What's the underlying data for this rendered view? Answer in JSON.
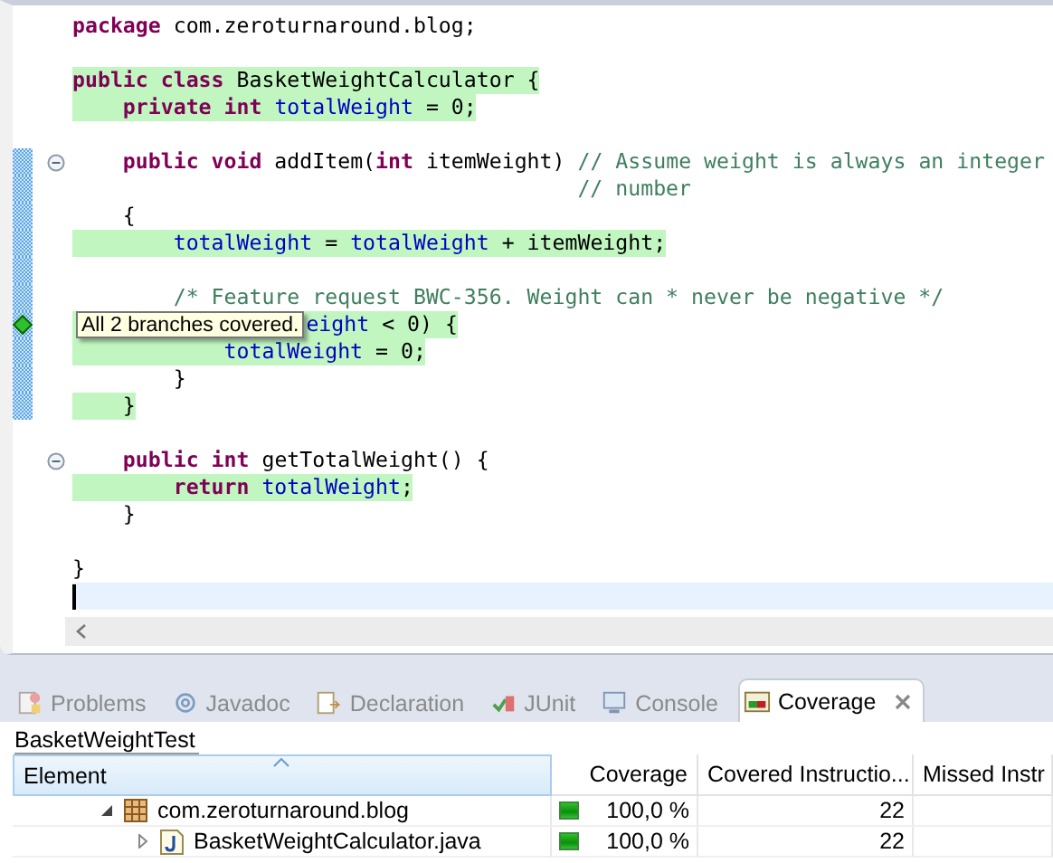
{
  "editor": {
    "lines": [
      {
        "kind": "code",
        "covered": false,
        "in_range": false,
        "fold": false,
        "tokens": [
          {
            "kind": "keyword",
            "text": "package"
          },
          {
            "kind": "plain",
            "text": " com.zeroturnaround.blog;"
          }
        ]
      },
      {
        "kind": "blank",
        "in_range": false
      },
      {
        "kind": "code",
        "covered": true,
        "in_range": false,
        "fold": false,
        "tokens": [
          {
            "kind": "keyword",
            "text": "public class"
          },
          {
            "kind": "plain",
            "text": " BasketWeightCalculator {"
          }
        ]
      },
      {
        "kind": "code",
        "covered": true,
        "in_range": false,
        "fold": false,
        "tokens": [
          {
            "kind": "keyword",
            "text": "    private int "
          },
          {
            "kind": "field",
            "text": "totalWeight"
          },
          {
            "kind": "plain",
            "text": " = 0;"
          }
        ]
      },
      {
        "kind": "blank",
        "in_range": false
      },
      {
        "kind": "code",
        "covered": false,
        "in_range": true,
        "fold": true,
        "tokens": [
          {
            "kind": "keyword",
            "text": "    public void"
          },
          {
            "kind": "plain",
            "text": " addItem("
          },
          {
            "kind": "keyword",
            "text": "int"
          },
          {
            "kind": "plain",
            "text": " itemWeight) "
          },
          {
            "kind": "comment",
            "text": "// Assume weight is always an integer"
          }
        ]
      },
      {
        "kind": "code",
        "covered": false,
        "in_range": true,
        "fold": false,
        "tokens": [
          {
            "kind": "comment",
            "text": "                                        // number"
          }
        ]
      },
      {
        "kind": "code",
        "covered": false,
        "in_range": true,
        "fold": false,
        "tokens": [
          {
            "kind": "plain",
            "text": "    {"
          }
        ]
      },
      {
        "kind": "code",
        "covered": true,
        "in_range": true,
        "fold": false,
        "tokens": [
          {
            "kind": "field",
            "text": "        totalWeight"
          },
          {
            "kind": "plain",
            "text": " = "
          },
          {
            "kind": "field",
            "text": "totalWeight"
          },
          {
            "kind": "plain",
            "text": " + itemWeight;"
          }
        ]
      },
      {
        "kind": "blank",
        "in_range": true
      },
      {
        "kind": "code",
        "covered": false,
        "in_range": true,
        "fold": false,
        "tokens": [
          {
            "kind": "comment",
            "text": "        /* Feature request BWC-356. Weight can * never be negative */"
          }
        ]
      },
      {
        "kind": "code",
        "covered": true,
        "in_range": true,
        "fold": false,
        "branch_covered": true,
        "tooltip": "All 2 branches covered.",
        "tokens": [
          {
            "kind": "field",
            "text": "eight"
          },
          {
            "kind": "plain",
            "text": " < 0) {"
          }
        ]
      },
      {
        "kind": "code",
        "covered": true,
        "in_range": true,
        "fold": false,
        "tokens": [
          {
            "kind": "field",
            "text": "            totalWeight"
          },
          {
            "kind": "plain",
            "text": " = 0;"
          }
        ]
      },
      {
        "kind": "code",
        "covered": false,
        "in_range": true,
        "fold": false,
        "tokens": [
          {
            "kind": "plain",
            "text": "        }"
          }
        ]
      },
      {
        "kind": "code",
        "covered": true,
        "in_range": true,
        "fold": false,
        "tokens": [
          {
            "kind": "plain",
            "text": "    }"
          }
        ]
      },
      {
        "kind": "blank",
        "in_range": false
      },
      {
        "kind": "code",
        "covered": false,
        "in_range": false,
        "fold": true,
        "tokens": [
          {
            "kind": "keyword",
            "text": "    public int"
          },
          {
            "kind": "plain",
            "text": " getTotalWeight() {"
          }
        ]
      },
      {
        "kind": "code",
        "covered": true,
        "in_range": false,
        "fold": false,
        "tokens": [
          {
            "kind": "keyword",
            "text": "        return "
          },
          {
            "kind": "field",
            "text": "totalWeight"
          },
          {
            "kind": "plain",
            "text": ";"
          }
        ]
      },
      {
        "kind": "code",
        "covered": false,
        "in_range": false,
        "fold": false,
        "tokens": [
          {
            "kind": "plain",
            "text": "    }"
          }
        ]
      },
      {
        "kind": "blank",
        "in_range": false
      },
      {
        "kind": "code",
        "covered": false,
        "in_range": false,
        "fold": false,
        "tokens": [
          {
            "kind": "plain",
            "text": "}"
          }
        ]
      },
      {
        "kind": "cursor",
        "in_range": false
      }
    ]
  },
  "tabs": [
    {
      "label": "Problems",
      "kind": "problems",
      "selected": false
    },
    {
      "label": "Javadoc",
      "kind": "javadoc",
      "selected": false
    },
    {
      "label": "Declaration",
      "kind": "declaration",
      "selected": false
    },
    {
      "label": "JUnit",
      "kind": "junit",
      "selected": false
    },
    {
      "label": "Console",
      "kind": "console",
      "selected": false
    },
    {
      "label": "Coverage",
      "kind": "coverage",
      "selected": true
    }
  ],
  "session": "BasketWeightTest",
  "table": {
    "columns": [
      "Element",
      "Coverage",
      "Covered Instructio...",
      "Missed Instr"
    ],
    "rows": [
      {
        "kind": "package",
        "name": "com.zeroturnaround.blog",
        "expanded": true,
        "level": 1.0,
        "coverage": "100,0 %",
        "covered": "22",
        "children": [
          {
            "kind": "file",
            "name": "BasketWeightCalculator.java",
            "expanded": false,
            "level": 1.0,
            "coverage": "100,0 %",
            "covered": "22"
          }
        ]
      }
    ]
  }
}
